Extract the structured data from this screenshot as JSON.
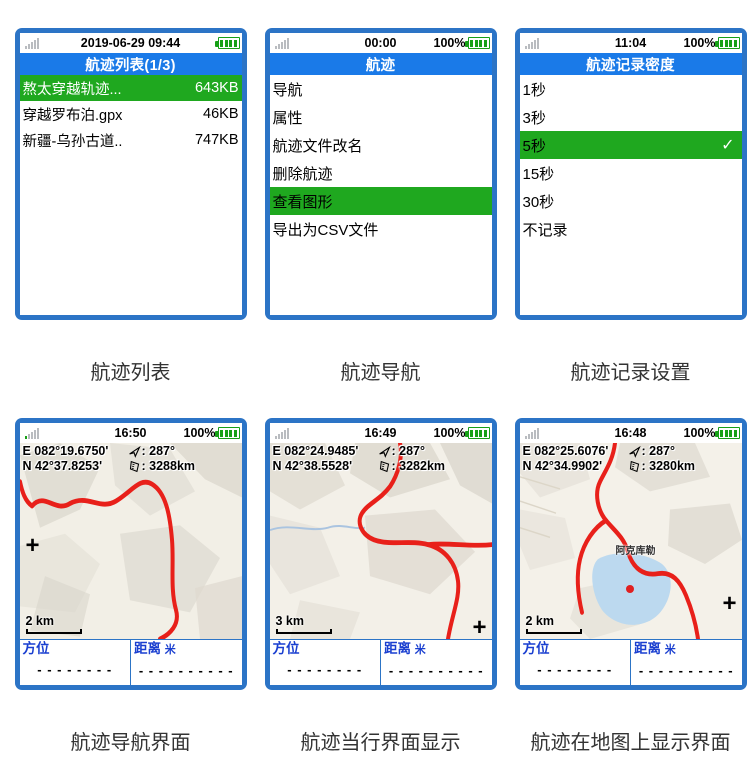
{
  "panels": [
    {
      "caption": "航迹列表",
      "status": {
        "time": "2019-06-29 09:44",
        "battery_pct": "",
        "signal_icon": "signal-bars-icon",
        "battery_icon": "battery-full-icon"
      },
      "title": "航迹列表(1/3)",
      "items": [
        {
          "name": "熬太穿越轨迹...",
          "size": "643KB",
          "selected": true
        },
        {
          "name": "穿越罗布泊.gpx",
          "size": "46KB",
          "selected": false
        },
        {
          "name": "新疆-乌孙古道..",
          "size": "747KB",
          "selected": false
        }
      ]
    },
    {
      "caption": "航迹导航",
      "status": {
        "time": "00:00",
        "battery_pct": "100%",
        "signal_icon": "signal-bars-icon",
        "battery_icon": "battery-full-icon"
      },
      "title": "航迹",
      "menu": [
        {
          "label": "导航",
          "selected": false
        },
        {
          "label": "属性",
          "selected": false
        },
        {
          "label": "航迹文件改名",
          "selected": false
        },
        {
          "label": "删除航迹",
          "selected": false
        },
        {
          "label": "查看图形",
          "selected": true
        },
        {
          "label": "导出为CSV文件",
          "selected": false
        }
      ]
    },
    {
      "caption": "航迹记录设置",
      "status": {
        "time": "11:04",
        "battery_pct": "100%",
        "signal_icon": "signal-bars-icon",
        "battery_icon": "battery-full-icon"
      },
      "title": "航迹记录密度",
      "options": [
        {
          "label": "1秒",
          "selected": false,
          "check": ""
        },
        {
          "label": "3秒",
          "selected": false,
          "check": ""
        },
        {
          "label": "5秒",
          "selected": true,
          "check": "✓"
        },
        {
          "label": "15秒",
          "selected": false,
          "check": ""
        },
        {
          "label": "30秒",
          "selected": false,
          "check": ""
        },
        {
          "label": "不记录",
          "selected": false,
          "check": ""
        }
      ]
    }
  ],
  "maps": [
    {
      "caption": "航迹导航界面",
      "status": {
        "time": "16:50",
        "battery_pct": "100%"
      },
      "lon": "E 082°19.6750'",
      "lat": "N  42°37.8253'",
      "heading_icon": "arrow-heading-icon",
      "heading": ": 287°",
      "distance_icon": "ruler-icon",
      "distance": ": 3288km",
      "scale": "2 km",
      "place": "",
      "info": {
        "bearing_label": "方位",
        "bearing_value": "- - - - - - - -",
        "distance_label": "距离",
        "distance_unit": "米",
        "distance_value": "- - - - - - - - - -"
      }
    },
    {
      "caption": "航迹当行界面显示",
      "status": {
        "time": "16:49",
        "battery_pct": "100%"
      },
      "lon": "E 082°24.9485'",
      "lat": "N  42°38.5528'",
      "heading_icon": "arrow-heading-icon",
      "heading": ": 287°",
      "distance_icon": "ruler-icon",
      "distance": ": 3282km",
      "scale": "3 km",
      "place": "",
      "info": {
        "bearing_label": "方位",
        "bearing_value": "- - - - - - - -",
        "distance_label": "距离",
        "distance_unit": "米",
        "distance_value": "- - - - - - - - - -"
      }
    },
    {
      "caption": "航迹在地图上显示界面",
      "status": {
        "time": "16:48",
        "battery_pct": "100%"
      },
      "lon": "E 082°25.6076'",
      "lat": "N  42°34.9902'",
      "heading_icon": "arrow-heading-icon",
      "heading": ": 287°",
      "distance_icon": "ruler-icon",
      "distance": ": 3280km",
      "scale": "2 km",
      "place": "阿克库勒",
      "info": {
        "bearing_label": "方位",
        "bearing_value": "- - - - - - - -",
        "distance_label": "距离",
        "distance_unit": "米",
        "distance_value": "- - - - - - - - - -"
      }
    }
  ],
  "colors": {
    "frame_blue": "#2c74c6",
    "title_blue": "#1a7ae8",
    "select_green": "#1fa81f",
    "track_red": "#e8201a",
    "label_blue": "#1a3fd0"
  }
}
